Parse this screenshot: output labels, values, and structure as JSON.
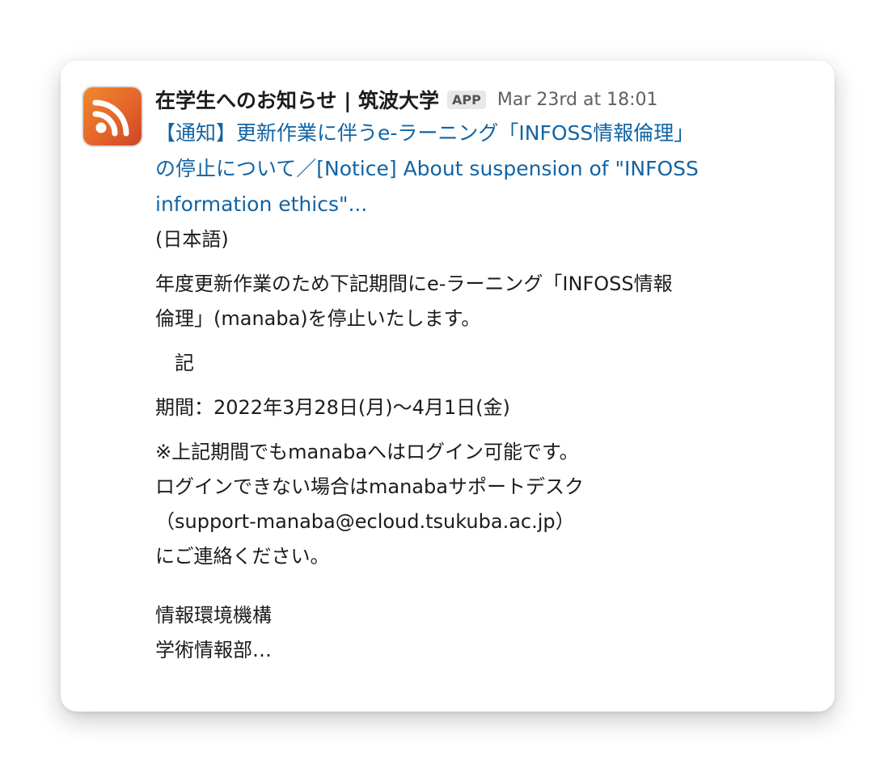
{
  "message": {
    "sender": "在学生へのお知らせ | 筑波大学",
    "badge": "APP",
    "timestamp": "Mar 23rd at 18:01",
    "title_lines": [
      "【通知】更新作業に伴うe-ラーニング「INFOSS情報倫理」",
      "の停止について／[Notice] About suspension of \"INFOSS",
      "information ethics\"..."
    ],
    "body": {
      "lang": "(日本語)",
      "p1": [
        "年度更新作業のため下記期間にe-ラーニング「INFOSS情報",
        "倫理」(manaba)を停止いたします。"
      ],
      "ki": "　記",
      "period": "期間：2022年3月28日(月)～4月1日(金)",
      "p2": [
        "※上記期間でもmanabaへはログイン可能です。",
        "ログインできない場合はmanabaサポートデスク",
        "（support-manaba@ecloud.tsukuba.ac.jp）",
        "にご連絡ください。"
      ],
      "sig": [
        "情報環境機構",
        "学術情報部…"
      ]
    }
  },
  "colors": {
    "link": "#1264a3",
    "icon": "#e2622a"
  },
  "icon": "rss-feed-icon"
}
